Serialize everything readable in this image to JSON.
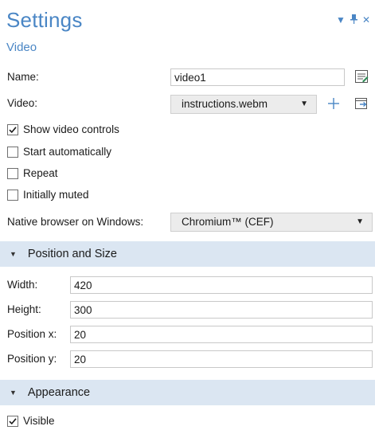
{
  "header": {
    "title": "Settings",
    "subtitle": "Video",
    "controls": [
      "dropdown-arrow-icon",
      "pin-icon",
      "close-icon"
    ]
  },
  "general": {
    "name_label": "Name:",
    "name_value": "video1",
    "video_label": "Video:",
    "video_value": "instructions.webm"
  },
  "checkboxes": [
    {
      "label": "Show video controls",
      "checked": true
    },
    {
      "label": "Start automatically",
      "checked": false
    },
    {
      "label": "Repeat",
      "checked": false
    },
    {
      "label": "Initially muted",
      "checked": false
    }
  ],
  "browser": {
    "label": "Native browser on Windows:",
    "value": "Chromium™ (CEF)"
  },
  "position_size": {
    "header": "Position and Size",
    "width_label": "Width:",
    "width_value": "420",
    "height_label": "Height:",
    "height_value": "300",
    "posx_label": "Position x:",
    "posx_value": "20",
    "posy_label": "Position y:",
    "posy_value": "20"
  },
  "appearance": {
    "header": "Appearance",
    "visible_label": "Visible",
    "visible_checked": true
  },
  "colors": {
    "accent": "#4a86c5",
    "section_bg": "#dbe6f2",
    "combo_bg": "#ececec",
    "icon_green": "#2e8b57"
  }
}
